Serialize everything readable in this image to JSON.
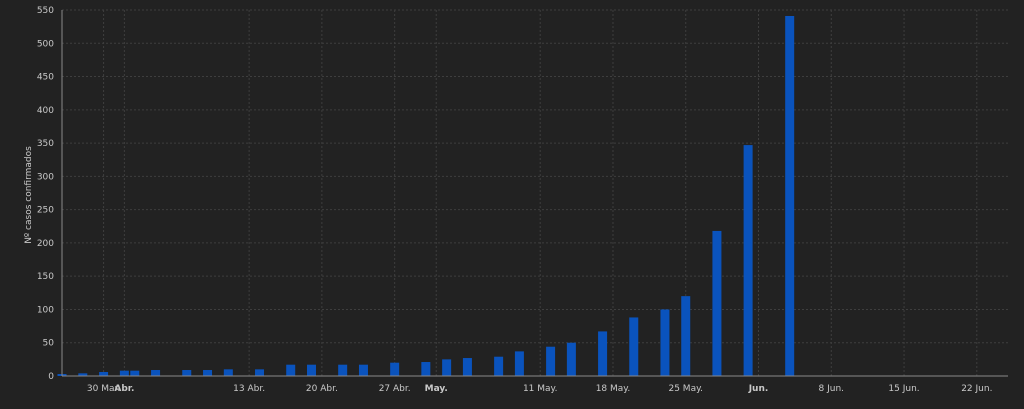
{
  "colors": {
    "background": "#222222",
    "bar": "#0a53bd",
    "grid": "#3e3e3e",
    "text": "#c9c9c9",
    "axis": "#8a8a8a"
  },
  "chart_data": {
    "type": "bar",
    "ylabel": "Nº casos confirmados",
    "ylim": [
      0,
      550
    ],
    "yticks": [
      0,
      50,
      100,
      150,
      200,
      250,
      300,
      350,
      400,
      450,
      500,
      550
    ],
    "xlim": [
      "2020-03-26",
      "2020-06-25"
    ],
    "grid": true,
    "x_ticks": [
      {
        "date": "2020-03-30",
        "label": "30 Mar.",
        "bold": false
      },
      {
        "date": "2020-04-01",
        "label": "Abr.",
        "bold": true
      },
      {
        "date": "2020-04-13",
        "label": "13 Abr.",
        "bold": false
      },
      {
        "date": "2020-04-20",
        "label": "20 Abr.",
        "bold": false
      },
      {
        "date": "2020-04-27",
        "label": "27 Abr.",
        "bold": false
      },
      {
        "date": "2020-05-01",
        "label": "May.",
        "bold": true
      },
      {
        "date": "2020-05-11",
        "label": "11 May.",
        "bold": false
      },
      {
        "date": "2020-05-18",
        "label": "18 May.",
        "bold": false
      },
      {
        "date": "2020-05-25",
        "label": "25 May.",
        "bold": false
      },
      {
        "date": "2020-06-01",
        "label": "Jun.",
        "bold": true
      },
      {
        "date": "2020-06-08",
        "label": "8 Jun.",
        "bold": false
      },
      {
        "date": "2020-06-15",
        "label": "15 Jun.",
        "bold": false
      },
      {
        "date": "2020-06-22",
        "label": "22 Jun.",
        "bold": false
      }
    ],
    "series": [
      {
        "points": [
          {
            "date": "2020-03-26",
            "value": 3
          },
          {
            "date": "2020-03-28",
            "value": 4
          },
          {
            "date": "2020-03-30",
            "value": 6
          },
          {
            "date": "2020-04-01",
            "value": 8
          },
          {
            "date": "2020-04-02",
            "value": 8
          },
          {
            "date": "2020-04-04",
            "value": 9
          },
          {
            "date": "2020-04-07",
            "value": 9
          },
          {
            "date": "2020-04-09",
            "value": 9
          },
          {
            "date": "2020-04-11",
            "value": 10
          },
          {
            "date": "2020-04-14",
            "value": 10
          },
          {
            "date": "2020-04-17",
            "value": 17
          },
          {
            "date": "2020-04-19",
            "value": 17
          },
          {
            "date": "2020-04-22",
            "value": 17
          },
          {
            "date": "2020-04-24",
            "value": 17
          },
          {
            "date": "2020-04-27",
            "value": 20
          },
          {
            "date": "2020-04-30",
            "value": 21
          },
          {
            "date": "2020-05-02",
            "value": 25
          },
          {
            "date": "2020-05-04",
            "value": 27
          },
          {
            "date": "2020-05-07",
            "value": 29
          },
          {
            "date": "2020-05-09",
            "value": 37
          },
          {
            "date": "2020-05-12",
            "value": 44
          },
          {
            "date": "2020-05-14",
            "value": 50
          },
          {
            "date": "2020-05-17",
            "value": 67
          },
          {
            "date": "2020-05-20",
            "value": 88
          },
          {
            "date": "2020-05-23",
            "value": 100
          },
          {
            "date": "2020-05-25",
            "value": 120
          },
          {
            "date": "2020-05-28",
            "value": 218
          },
          {
            "date": "2020-05-31",
            "value": 347
          },
          {
            "date": "2020-06-04",
            "value": 541
          }
        ]
      }
    ]
  }
}
